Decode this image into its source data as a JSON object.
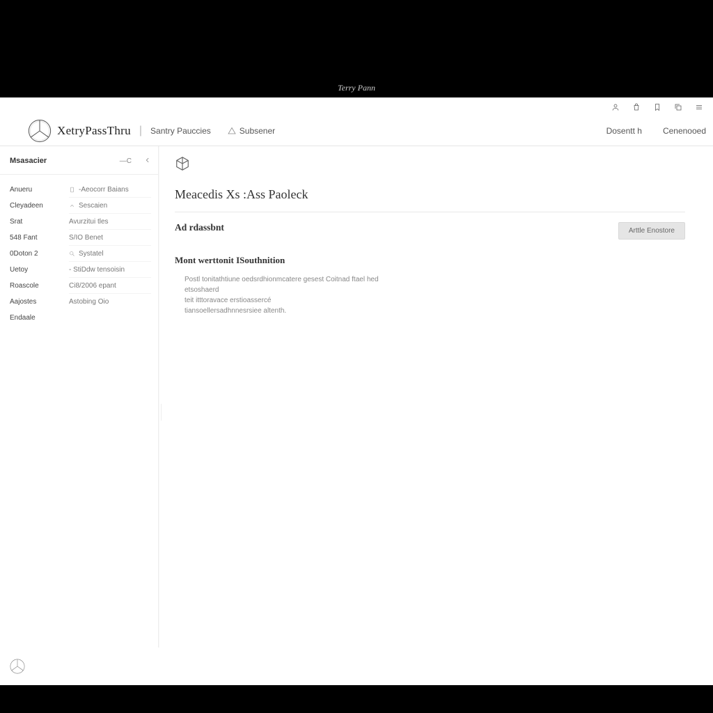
{
  "window_title": "Terry Pann",
  "brand": "XetryPassThru",
  "top_nav": {
    "purchases": "Santry Pauccies",
    "subscriber": "Subsener"
  },
  "right_nav": {
    "account": "Dosentt h",
    "connected": "Cenenooed"
  },
  "sidebar": {
    "header": "Msasacier",
    "toggle_label": "—C",
    "left_items": [
      "Anueru",
      "Cleyadeen",
      "Srat",
      "548 Fant",
      "0Doton 2",
      "Uetoy",
      "Roascole",
      "Aajostes",
      "Endaale"
    ],
    "right_items": [
      "-Aeocorr Baians",
      "Sescaien",
      "Avurzitui tles",
      "S/IO Benet",
      "Systatel",
      "- StiDdw tensoisin",
      "Ci8/2006 epant",
      "Astobing Oio"
    ]
  },
  "main": {
    "title": "Meacedis Xs :Ass Paoleck",
    "section_a": "Ad rdassbnt",
    "button": "Arttle Enostore",
    "section_b": "Mont werttonit ISouthnition",
    "description_l1": "Postl tonitathtiune oedsrdhionmcatere gesest Coitnad ftael hed etsoshaerd",
    "description_l2": "teit itttoravace erstioassercé",
    "description_l3": "tiansoellersadhnnesrsiee altenth."
  }
}
